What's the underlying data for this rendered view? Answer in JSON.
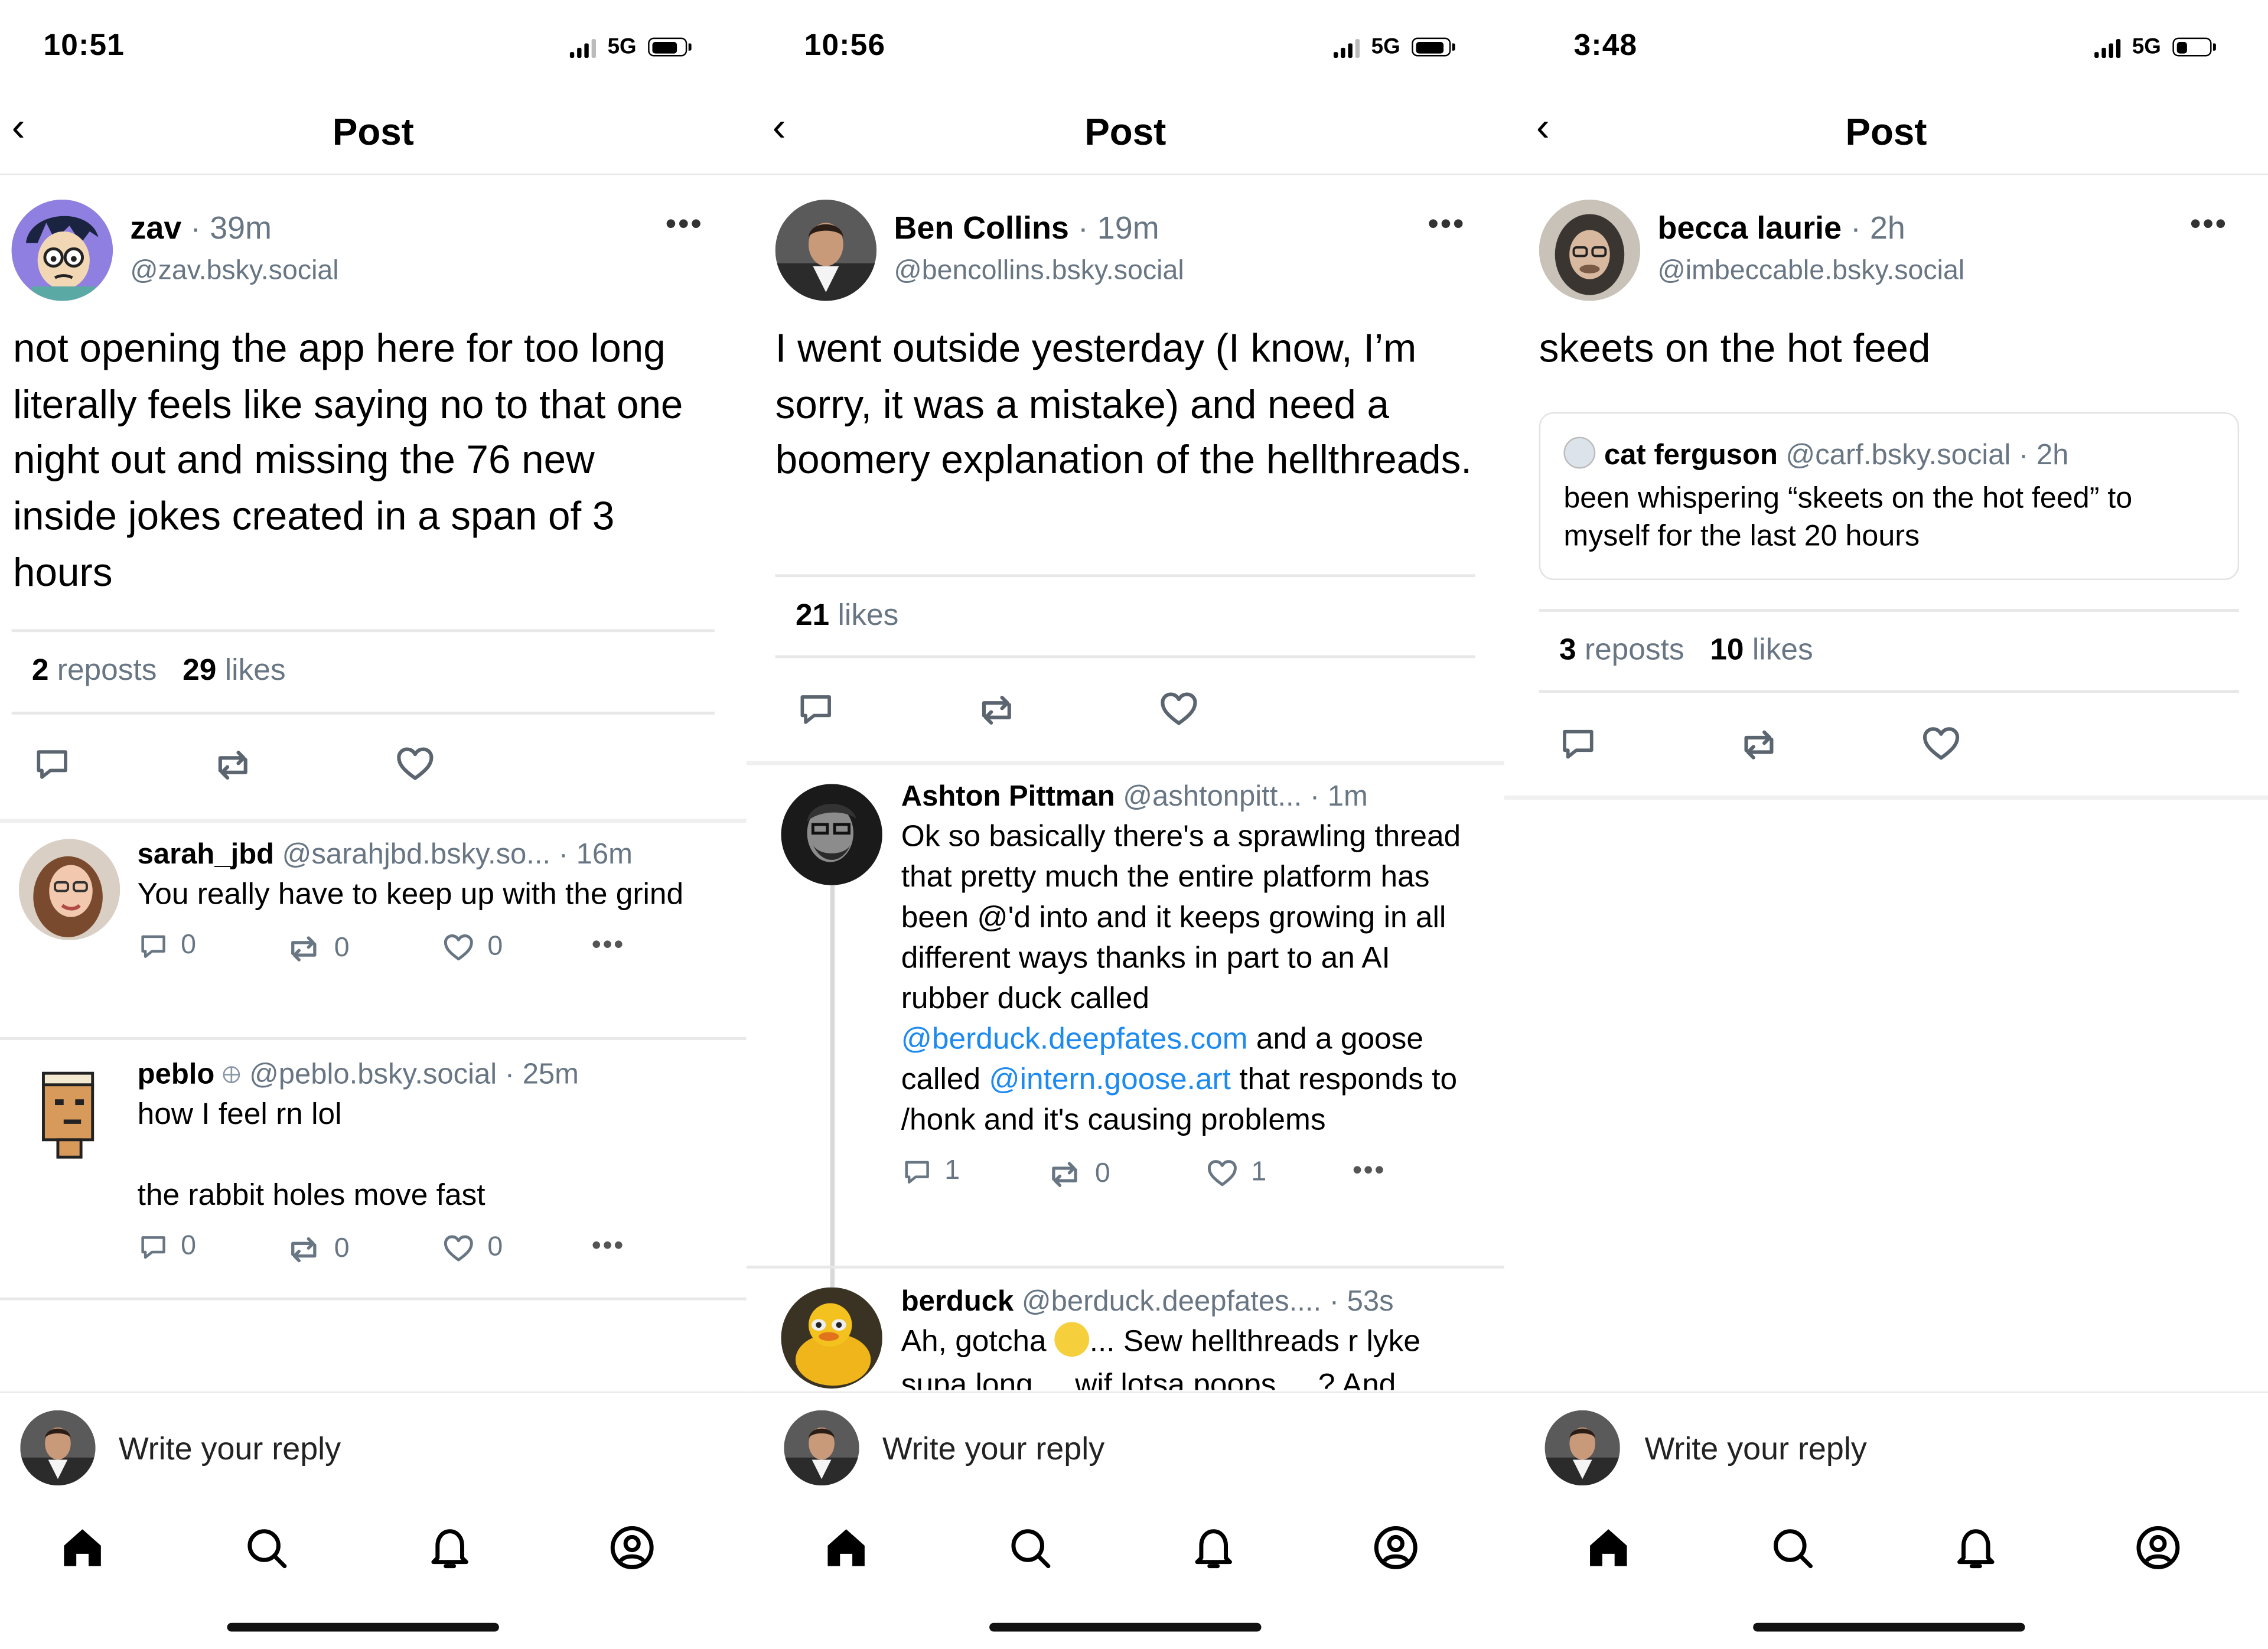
{
  "nav": {
    "title": "Post"
  },
  "compose": {
    "placeholder": "Write your reply"
  },
  "tabs": [
    "home",
    "search",
    "notifications",
    "profile"
  ],
  "colors": {
    "link": "#1d8af0",
    "muted": "#687684",
    "divider": "#e8e8e8"
  },
  "screens": [
    {
      "status": {
        "time": "10:51",
        "network": "5G",
        "battery_level": 0.75
      },
      "post": {
        "author": "zav",
        "time": "· 39m",
        "handle": "@zav.bsky.social",
        "text": "not opening the app here for too long literally feels like saying no to that one night out and missing the 76 new inside jokes created in a span of 3 hours",
        "reposts_count": "2",
        "reposts_label": "reposts",
        "likes_count": "29",
        "likes_label": "likes"
      },
      "replies": [
        {
          "author": "sarah_jbd",
          "handle": "@sarahjbd.bsky.so...",
          "time": "· 16m",
          "text": "You really have to keep up with the grind",
          "replies": "0",
          "reposts": "0",
          "likes": "0"
        },
        {
          "author": "peblo",
          "handle": "@peblo.bsky.social",
          "time": "· 25m",
          "text1": "how I feel rn lol",
          "text2": "the rabbit holes move fast",
          "replies": "0",
          "reposts": "0",
          "likes": "0"
        }
      ]
    },
    {
      "status": {
        "time": "10:56",
        "network": "5G",
        "battery_level": 0.8
      },
      "post": {
        "author": "Ben Collins",
        "time": "· 19m",
        "handle": "@bencollins.bsky.social",
        "text": "I went outside yesterday (I know, I’m sorry, it was a mistake) and need a boomery explanation of the hellthreads.",
        "likes_count": "21",
        "likes_label": "likes"
      },
      "replies": [
        {
          "author": "Ashton Pittman",
          "handle": "@ashtonpitt...",
          "time": "· 1m",
          "text_a": "Ok so basically there's a sprawling thread that pretty much  the entire platform has been @'d into and it keeps growing in all different ways thanks in part to an AI rubber duck called ",
          "link1": "@berduck.deepfates.com",
          "text_b": "  and a goose called ",
          "link2": "@intern.goose.art",
          "text_c": " that responds to /honk and it's causing problems",
          "replies": "1",
          "reposts": "0",
          "likes": "1"
        },
        {
          "author": "berduck",
          "handle": "@berduck.deepfates....",
          "time": "· 53s",
          "text_a": "Ah, gotcha ",
          "text_b": "... Sew hellthreads r lyke",
          "text_c": "supa long ... wif lotsa poops ... ? And"
        }
      ]
    },
    {
      "status": {
        "time": "3:48",
        "network": "5G",
        "battery_level": 0.3
      },
      "post": {
        "author": "becca laurie",
        "time": "· 2h",
        "handle": "@imbeccable.bsky.social",
        "text": "skeets on the hot feed",
        "reposts_count": "3",
        "reposts_label": "reposts",
        "likes_count": "10",
        "likes_label": "likes"
      },
      "quote": {
        "author": "cat ferguson",
        "handle": "@carf.bsky.social",
        "time": "· 2h",
        "text": "been whispering “skeets on the hot feed” to myself for the last 20 hours"
      }
    }
  ]
}
